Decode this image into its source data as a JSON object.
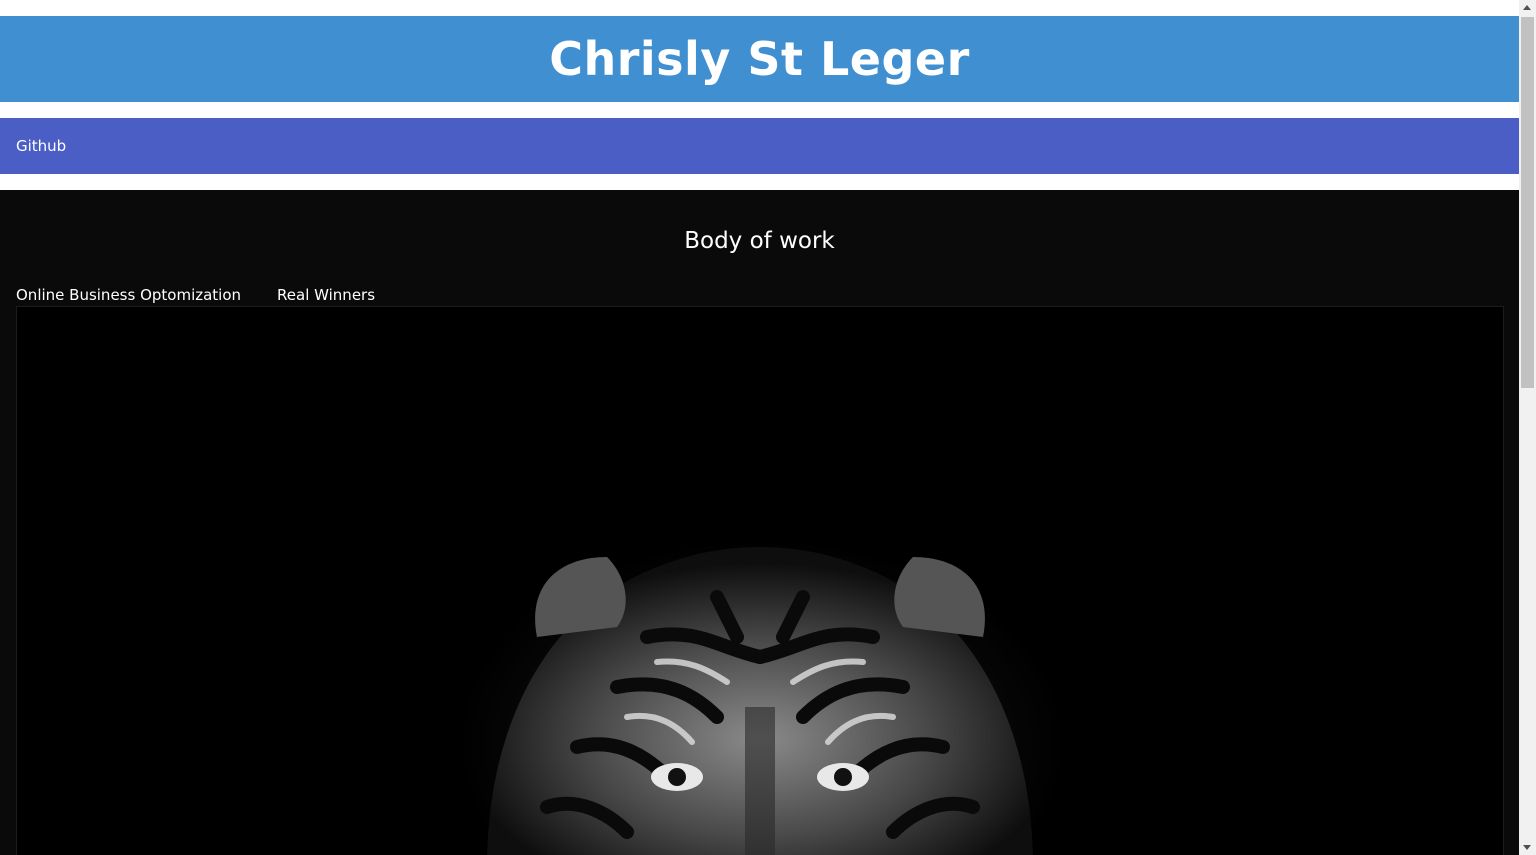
{
  "header": {
    "title": "Chrisly St Leger"
  },
  "nav": {
    "items": [
      {
        "label": "Github"
      }
    ]
  },
  "main": {
    "heading": "Body of work",
    "tabs": [
      {
        "label": "Online Business Optomization"
      },
      {
        "label": "Real Winners"
      }
    ],
    "image": {
      "subject": "tiger-image"
    }
  },
  "colors": {
    "header_bg": "#3f8fd1",
    "nav_bg": "#4a5ec6",
    "main_bg": "#0a0a0a"
  }
}
